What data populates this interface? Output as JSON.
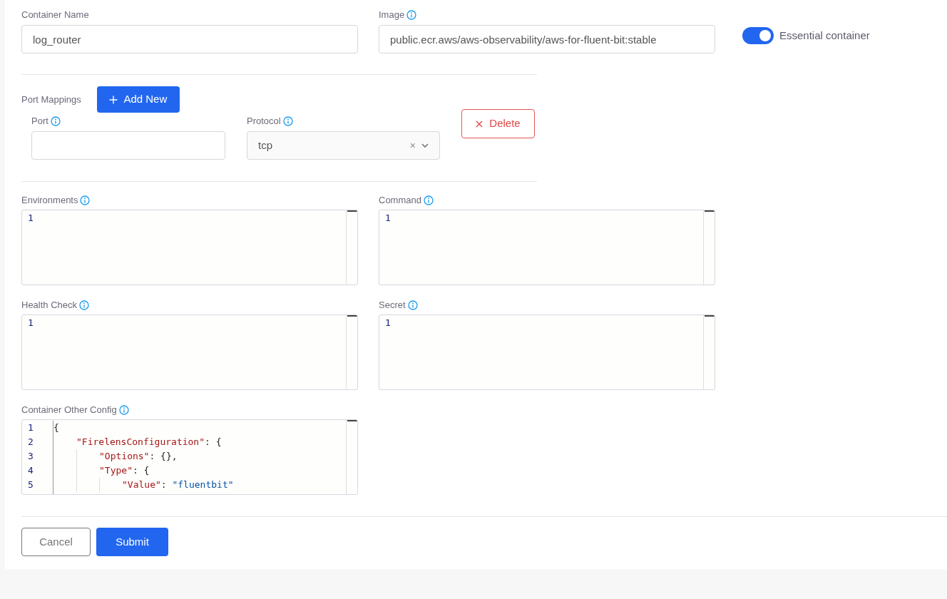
{
  "container_name": {
    "label": "Container Name",
    "value": "log_router"
  },
  "image": {
    "label": "Image",
    "value": "public.ecr.aws/aws-observability/aws-for-fluent-bit:stable"
  },
  "essential": {
    "label": "Essential container",
    "on": true
  },
  "port_mappings": {
    "label": "Port Mappings",
    "add_button": "Add New",
    "rows": [
      {
        "port_label": "Port",
        "port_value": "",
        "protocol_label": "Protocol",
        "protocol_value": "tcp",
        "clear": "×",
        "delete_button": "Delete"
      }
    ]
  },
  "editors": [
    {
      "label": "Environments",
      "lines": [
        {
          "number": "1"
        }
      ]
    },
    {
      "label": "Command",
      "lines": [
        {
          "number": "1"
        }
      ]
    },
    {
      "label": "Health Check",
      "lines": [
        {
          "number": "1"
        }
      ]
    },
    {
      "label": "Secret",
      "lines": [
        {
          "number": "1"
        }
      ]
    },
    {
      "label": "Container Other Config",
      "gutter": true,
      "lines": [
        {
          "number": "1",
          "tokens": [
            {
              "kind": "punct",
              "text": "{"
            }
          ]
        },
        {
          "number": "2",
          "tokens": [
            {
              "kind": "key",
              "text": "\"FirelensConfiguration\""
            },
            {
              "kind": "punct",
              "text": ": {"
            }
          ]
        },
        {
          "number": "3",
          "tokens": [
            {
              "kind": "key",
              "text": "\"Options\""
            },
            {
              "kind": "punct",
              "text": ": {},"
            }
          ]
        },
        {
          "number": "4",
          "tokens": [
            {
              "kind": "key",
              "text": "\"Type\""
            },
            {
              "kind": "punct",
              "text": ": {"
            }
          ]
        },
        {
          "number": "5",
          "tokens": [
            {
              "kind": "key",
              "text": "\"Value\""
            },
            {
              "kind": "punct",
              "text": ": "
            },
            {
              "kind": "string",
              "text": "\"fluentbit\""
            }
          ]
        }
      ]
    }
  ],
  "buttons": [
    {
      "kind": "secondary",
      "label": "Cancel"
    },
    {
      "kind": "primary",
      "label": "Submit"
    }
  ]
}
